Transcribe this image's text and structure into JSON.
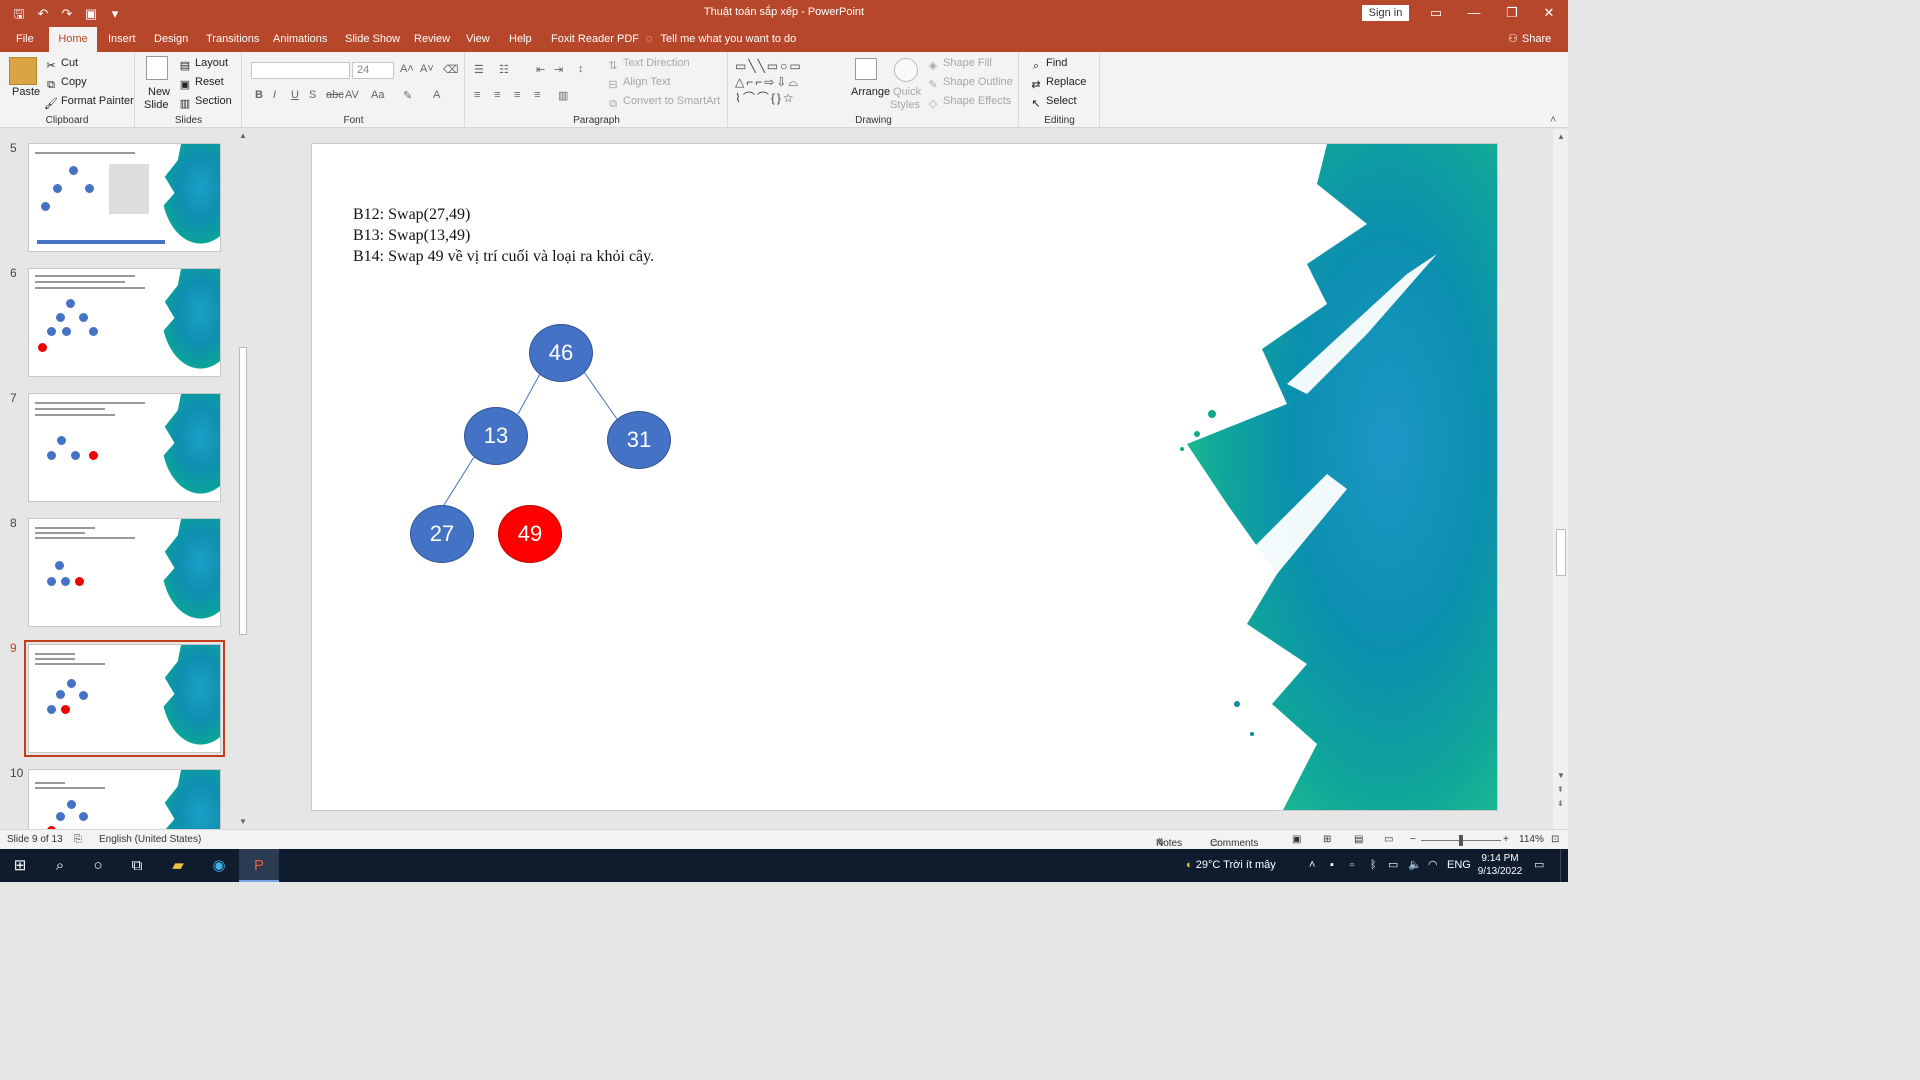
{
  "window": {
    "title": "Thuật toán sắp xếp  -  PowerPoint",
    "signin_label": "Sign in",
    "controls": {
      "ribbon_display": "▭",
      "minimize": "—",
      "restore": "❐",
      "close": "✕"
    }
  },
  "qat": {
    "save": "🖫",
    "undo": "↶",
    "redo": "↷",
    "present": "▣",
    "customize": "▾"
  },
  "tabs": [
    {
      "label": "File"
    },
    {
      "label": "Home"
    },
    {
      "label": "Insert"
    },
    {
      "label": "Design"
    },
    {
      "label": "Transitions"
    },
    {
      "label": "Animations"
    },
    {
      "label": "Slide Show"
    },
    {
      "label": "Review"
    },
    {
      "label": "View"
    },
    {
      "label": "Help"
    },
    {
      "label": "Foxit Reader PDF"
    }
  ],
  "tellme": "Tell me what you want to do",
  "share": "Share",
  "ribbon": {
    "clipboard": {
      "label": "Clipboard",
      "paste": "Paste",
      "cut": "Cut",
      "copy": "Copy",
      "format_painter": "Format Painter"
    },
    "slides": {
      "label": "Slides",
      "new_slide_1": "New",
      "new_slide_2": "Slide",
      "layout": "Layout",
      "reset": "Reset",
      "section": "Section"
    },
    "font": {
      "label": "Font",
      "font_name": "",
      "font_size": "24"
    },
    "paragraph": {
      "label": "Paragraph",
      "text_direction": "Text Direction",
      "align_text": "Align Text",
      "convert_smartart": "Convert to SmartArt"
    },
    "drawing": {
      "label": "Drawing",
      "arrange": "Arrange",
      "quick_styles_1": "Quick",
      "quick_styles_2": "Styles",
      "shape_fill": "Shape Fill",
      "shape_outline": "Shape Outline",
      "shape_effects": "Shape Effects"
    },
    "editing": {
      "label": "Editing",
      "find": "Find",
      "replace": "Replace",
      "select": "Select"
    }
  },
  "thumbnails": [
    {
      "number": "5"
    },
    {
      "number": "6"
    },
    {
      "number": "7"
    },
    {
      "number": "8"
    },
    {
      "number": "9",
      "selected": true
    },
    {
      "number": "10"
    }
  ],
  "slide": {
    "lines": [
      "B12: Swap(27,49)",
      "B13: Swap(13,49)",
      "B14: Swap 49 về vị trí cuối và loại ra khỏi cây."
    ],
    "nodes": [
      {
        "value": "46",
        "color": "#4472c4"
      },
      {
        "value": "13",
        "color": "#4472c4"
      },
      {
        "value": "31",
        "color": "#4472c4"
      },
      {
        "value": "27",
        "color": "#4472c4"
      },
      {
        "value": "49",
        "color": "#ff0000"
      }
    ]
  },
  "status": {
    "slide_info": "Slide 9 of 13",
    "language": "English (United States)",
    "notes": "Notes",
    "comments": "Comments",
    "zoom": "114%"
  },
  "taskbar": {
    "weather": "29°C  Trời ít mây",
    "lang": "ENG",
    "time": "9:14 PM",
    "date": "9/13/2022"
  },
  "colors": {
    "accent": "#b7472a",
    "node_blue": "#4472c4",
    "node_red": "#ff0000"
  }
}
